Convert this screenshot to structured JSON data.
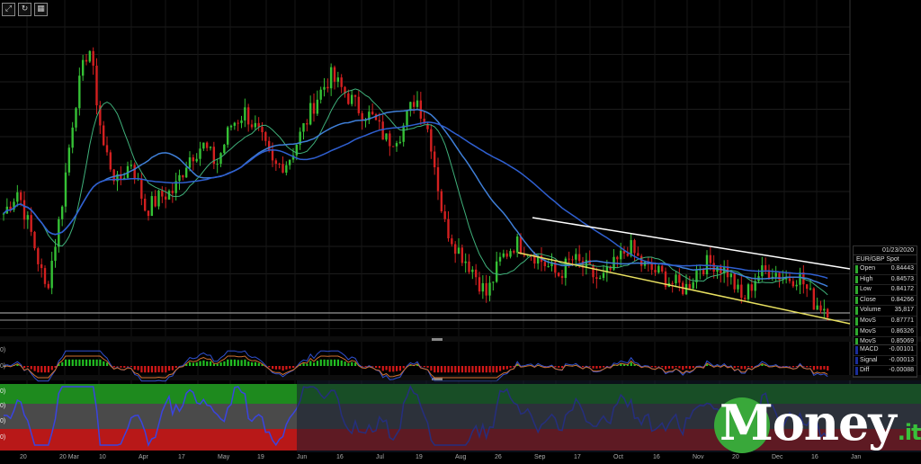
{
  "toolbar": {
    "expand_icon": "expand-icon",
    "refresh_icon": "refresh-icon",
    "grid_icon": "grid-icon"
  },
  "info_box": {
    "date": "01/23/2020",
    "instrument": "EUR/GBP Spot",
    "rows": [
      {
        "label": "Open",
        "value": "0.84443"
      },
      {
        "label": "High",
        "value": "0.84573"
      },
      {
        "label": "Low",
        "value": "0.84172"
      },
      {
        "label": "Close",
        "value": "0.84266"
      },
      {
        "label": "Volume",
        "value": "35,817"
      },
      {
        "label": "MovS",
        "value": "0.87771"
      },
      {
        "label": "MovS",
        "value": "0.86326"
      },
      {
        "label": "MovS",
        "value": "0.85069"
      }
    ]
  },
  "indicator_box": {
    "rows": [
      {
        "label": "MACD",
        "value": "-0.00101"
      },
      {
        "label": "Signal",
        "value": "-0.00013"
      },
      {
        "label": "Diff",
        "value": "-0.00088"
      }
    ]
  },
  "logo": {
    "main": "Money",
    "tld": ".it"
  },
  "xaxis_labels": [
    "20",
    "20 Mar",
    "10",
    "Apr",
    "17",
    "May",
    "19",
    "Jun",
    "16",
    "Jul",
    "19",
    "Aug",
    "26",
    "Sep",
    "17",
    "Oct",
    "16",
    "Nov",
    "20",
    "Dec",
    "16",
    "Jan"
  ],
  "chart_data": {
    "type": "line",
    "title": "",
    "instrument": "EUR/GBP Spot",
    "series": [
      {
        "name": "Close",
        "values": [
          0.872,
          0.879,
          0.865,
          0.848,
          0.872,
          0.905,
          0.924,
          0.893,
          0.881,
          0.888,
          0.873,
          0.877,
          0.879,
          0.889,
          0.893,
          0.887,
          0.899,
          0.903,
          0.896,
          0.886,
          0.888,
          0.897,
          0.907,
          0.914,
          0.909,
          0.904,
          0.901,
          0.894,
          0.897,
          0.908,
          0.896,
          0.869,
          0.861,
          0.855,
          0.847,
          0.858,
          0.863,
          0.861,
          0.857,
          0.853,
          0.858,
          0.855,
          0.851,
          0.856,
          0.862,
          0.856,
          0.854,
          0.851,
          0.849,
          0.856,
          0.857,
          0.854,
          0.845,
          0.853,
          0.855,
          0.852,
          0.853,
          0.845,
          0.843
        ]
      },
      {
        "name": "MovS",
        "values": [
          0.878
        ]
      },
      {
        "name": "MovS",
        "values": [
          0.863
        ]
      },
      {
        "name": "MovS",
        "values": [
          0.851
        ]
      }
    ],
    "trendlines": [
      "resistance",
      "support"
    ],
    "indicators": [
      "MACD",
      "Signal",
      "Diff"
    ],
    "colors": {
      "up": "#35c135",
      "down": "#d42020",
      "ma_fast": "#3fb07a",
      "ma_mid": "#3f7fd8",
      "ma_slow": "#2f5fd0",
      "upper_line": "#ffffff",
      "lower_line": "#e8e060"
    },
    "grid": true
  }
}
